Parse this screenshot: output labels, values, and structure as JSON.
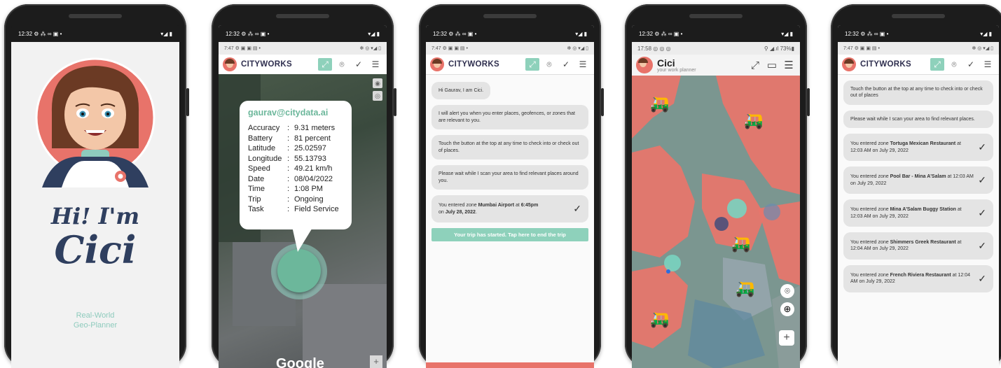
{
  "phone1": {
    "status_time": "12:32",
    "status_icons": "⚙ ⁂ ∞ ▣ •",
    "status_right": "▾◢ ▮",
    "greeting_line1": "Hi! I'm",
    "greeting_line2": "Cici",
    "tagline_line1": "Real-World",
    "tagline_line2": "Geo-Planner"
  },
  "phone2": {
    "status_time": "12:32",
    "status_icons": "⚙ ⁂ ∞ ▣ •",
    "status_right": "▾◢ ▮",
    "inner_time": "7:47",
    "inner_icons": "⚙ ▣ ▣ ▤ •",
    "inner_right": "✻ ◎ ▾◢ ▯",
    "brand": "CITYWORKS",
    "popup_email": "gaurav@citydata.ai",
    "stats": [
      {
        "label": "Accuracy",
        "value": "9.31 meters"
      },
      {
        "label": "Battery",
        "value": "81 percent"
      },
      {
        "label": "Latitude",
        "value": "25.02597"
      },
      {
        "label": "Longitude",
        "value": "55.13793"
      },
      {
        "label": "Speed",
        "value": "49.21 km/h"
      },
      {
        "label": "Date",
        "value": "08/04/2022"
      },
      {
        "label": "Time",
        "value": "1:08 PM"
      },
      {
        "label": "Trip",
        "value": "Ongoing"
      },
      {
        "label": "Task",
        "value": "Field Service"
      }
    ],
    "map_logo": "Google"
  },
  "phone3": {
    "status_time": "12:32",
    "status_icons": "⚙ ⁂ ∞ ▣ •",
    "status_right": "▾◢ ▮",
    "inner_time": "7:47",
    "inner_icons": "⚙ ▣ ▣ ▤ •",
    "inner_right": "✻ ◎ ▾◢ ▯",
    "brand": "CITYWORKS",
    "msg1": "Hi Gaurav, I am Cici.",
    "msg2": "I will alert you when you enter places, geofences, or zones that are relevant to you.",
    "msg3": "Touch the button at the top at any time to check into or check out of places.",
    "msg4": "Please wait while I scan your area to find relevant places around you.",
    "msg5_pre": "You entered zone ",
    "msg5_zone": "Mumbai Airport",
    "msg5_mid": " at ",
    "msg5_time": "6:45pm",
    "msg5_on": " on ",
    "msg5_date": "July 28, 2022",
    "msg5_end": ".",
    "trip_banner": "Your trip has started. Tap here to end the trip"
  },
  "phone4": {
    "status_time": "12:32",
    "status_icons": "⚙ ⁂ ∞ ▣ •",
    "status_right": "▾◢ ▮",
    "inner_time": "17:58",
    "inner_icons": "◎ ◎ ◎",
    "inner_right": "⚲ ◢.ıl 73%▮",
    "title": "Cici",
    "subtitle": "your work planner",
    "zoom_plus": "+"
  },
  "phone5": {
    "status_time": "12:32",
    "status_icons": "⚙ ⁂ ∞ ▣ •",
    "status_right": "▾◢ ▮",
    "inner_time": "7:47",
    "inner_icons": "⚙ ▣ ▣ ▤ •",
    "inner_right": "✻ ◎ ▾◢ ▯",
    "brand": "CITYWORKS",
    "msg1": "Touch the button at the top at any time to check into or check out of places",
    "msg2": "Please wait while I scan your area to find relevant places.",
    "entries": [
      {
        "pre": "You entered zone ",
        "zone": "Tortuga Mexican Restaurant",
        "post": " at 12:03 AM on July 29, 2022"
      },
      {
        "pre": "You entered zone ",
        "zone": "Pool Bar - Mina A'Salam",
        "post": " at 12:03 AM on July 29, 2022"
      },
      {
        "pre": "You entered zone ",
        "zone": "Mina A'Salam Buggy Station",
        "post": " at 12:03 AM on July 29, 2022"
      },
      {
        "pre": "You entered zone ",
        "zone": "Shimmers Greek Restaurant",
        "post": " at 12:04 AM on July 29, 2022"
      },
      {
        "pre": "You entered zone ",
        "zone": "French Riviera Restaurant",
        "post": " at 12:04 AM on July 29, 2022"
      }
    ]
  },
  "colors": {
    "accent": "#8ed1bb",
    "coral": "#e8736a",
    "navy": "#2f3f5f",
    "zone_red": "#e8756b"
  },
  "icons": [
    "route-icon",
    "location-pin-icon",
    "check-icon",
    "menu-icon",
    "chat-icon",
    "globe-icon",
    "golf-cart-icon"
  ]
}
